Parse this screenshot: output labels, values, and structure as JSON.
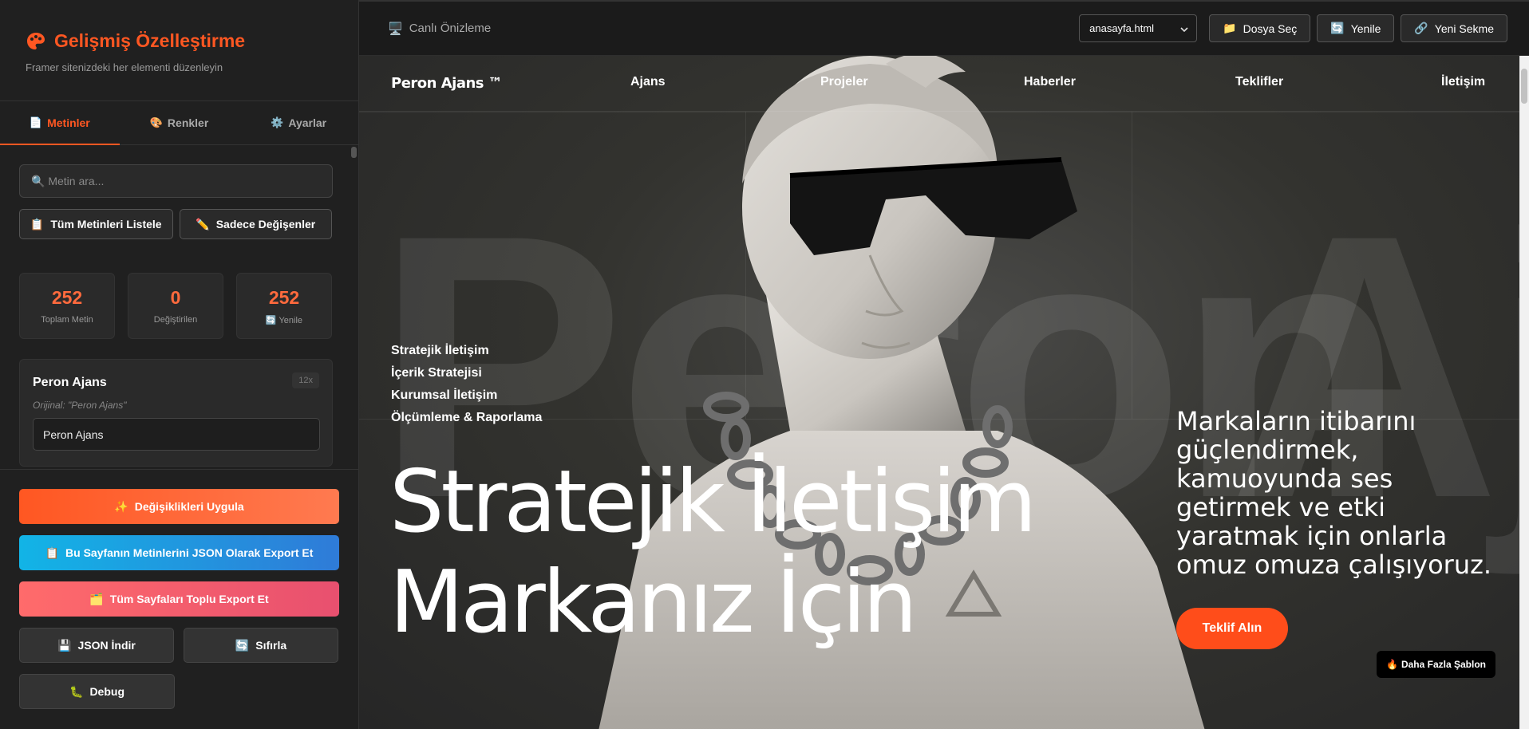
{
  "sidebar": {
    "title": "Gelişmiş Özelleştirme",
    "subtitle": "Framer sitenizdeki her elementi düzenleyin",
    "tabs": [
      {
        "label": "Metinler",
        "icon": "document-icon",
        "emoji": "📄"
      },
      {
        "label": "Renkler",
        "icon": "palette-icon",
        "emoji": "🎨"
      },
      {
        "label": "Ayarlar",
        "icon": "gear-icon",
        "emoji": "⚙️"
      }
    ],
    "search": {
      "placeholder": "🔍 Metin ara...",
      "value": ""
    },
    "list_all_button": "Tüm Metinleri Listele",
    "only_changed_button": "Sadece Değişenler",
    "stats": [
      {
        "value": "252",
        "label": "Toplam Metin"
      },
      {
        "value": "0",
        "label": "Değiştirilen"
      },
      {
        "value": "252",
        "label": "Yenile"
      }
    ],
    "entry": {
      "title": "Peron Ajans",
      "count": "12x",
      "original": "Orijinal: \"Peron Ajans\"",
      "value": "Peron Ajans"
    },
    "actions": {
      "apply": "Değişiklikleri Uygula",
      "export_json": "Bu Sayfanın Metinlerini JSON Olarak Export Et",
      "export_all": "Tüm Sayfaları Toplu Export Et",
      "download_json": "JSON İndir",
      "reset": "Sıfırla",
      "debug": "Debug"
    }
  },
  "topbar": {
    "label": "Canlı Önizleme",
    "file_select": {
      "selected": "anasayfa.html"
    },
    "choose_file": "Dosya Seç",
    "refresh": "Yenile",
    "new_tab": "Yeni Sekme"
  },
  "preview": {
    "logo": "Peron Ajans ™",
    "nav": [
      "Ajans",
      "Projeler",
      "Haberler",
      "Teklifler",
      "İletişim"
    ],
    "services": [
      "Stratejik İletişim",
      "İçerik Stratejisi",
      "Kurumsal İletişim",
      "Ölçümleme & Raporlama"
    ],
    "headline_line1": "Stratejik İletişim",
    "headline_line2": "Markanız İçin",
    "background_text_left": "Peron",
    "background_text_right": "Aj",
    "tagline": "Markaların itibarını güçlendirmek, kamuoyunda ses getirmek ve etki yaratmak için onlarla omuz omuza çalışıyoruz.",
    "cta": "Teklif Alın",
    "more_templates": "Daha Fazla Şablon"
  },
  "colors": {
    "accent": "#ff5722",
    "cta": "#ff4d1a",
    "sidebar_bg": "#202020",
    "main_bg": "#1b1b1b"
  }
}
